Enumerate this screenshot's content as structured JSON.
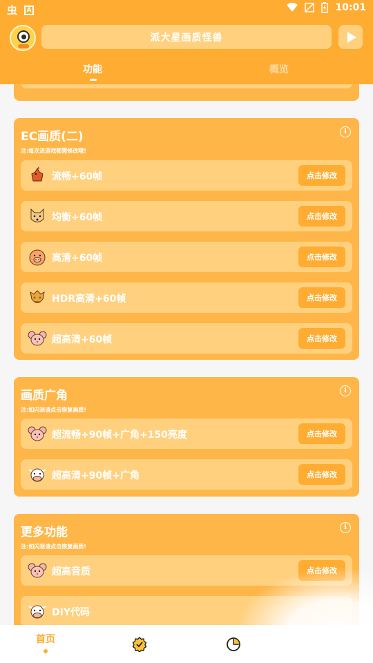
{
  "status_bar": {
    "left_icons": [
      "bug-icon",
      "a-icon"
    ],
    "right_icons": [
      "wifi-icon",
      "signal-off-icon",
      "battery-charging-icon"
    ],
    "time": "10:01"
  },
  "header": {
    "title": "派大星画质怪兽",
    "tabs": [
      {
        "label": "功能",
        "active": true
      },
      {
        "label": "概览",
        "active": false
      }
    ]
  },
  "sections": [
    {
      "title": "EC画质(二)",
      "note": "注:每次进游戏都需修改哦!",
      "items": [
        {
          "icon": "rooster-icon",
          "label": "流畅+60帧",
          "action": "点击修改"
        },
        {
          "icon": "dog-icon",
          "label": "均衡+60帧",
          "action": "点击修改"
        },
        {
          "icon": "pig-icon",
          "label": "高清+60帧",
          "action": "点击修改"
        },
        {
          "icon": "dragon-icon",
          "label": "HDR高清+60帧",
          "action": "点击修改"
        },
        {
          "icon": "rat-icon",
          "label": "超高清+60帧",
          "action": "点击修改"
        }
      ]
    },
    {
      "title": "画质广角",
      "note": "注:如闪退请点击恢复画质!",
      "items": [
        {
          "icon": "rat-icon",
          "label": "超流畅+90帧+广角+150亮度",
          "action": "点击修改"
        },
        {
          "icon": "ox-icon",
          "label": "超高清+90帧+广角",
          "action": "点击修改"
        }
      ]
    },
    {
      "title": "更多功能",
      "note": "注:如闪退请点击恢复画质!",
      "items": [
        {
          "icon": "rat-icon",
          "label": "超高音质",
          "action": "点击修改"
        },
        {
          "icon": "ox-icon",
          "label": "DIY代码",
          "action": ""
        }
      ]
    }
  ],
  "bottom_nav": {
    "home_label": "首页",
    "icons": [
      "badge-check-icon",
      "pie-chart-icon"
    ]
  },
  "colors": {
    "primary": "#ffac33",
    "card": "#ffb648",
    "row": "#ffd07e",
    "background": "#f6f6f6"
  }
}
